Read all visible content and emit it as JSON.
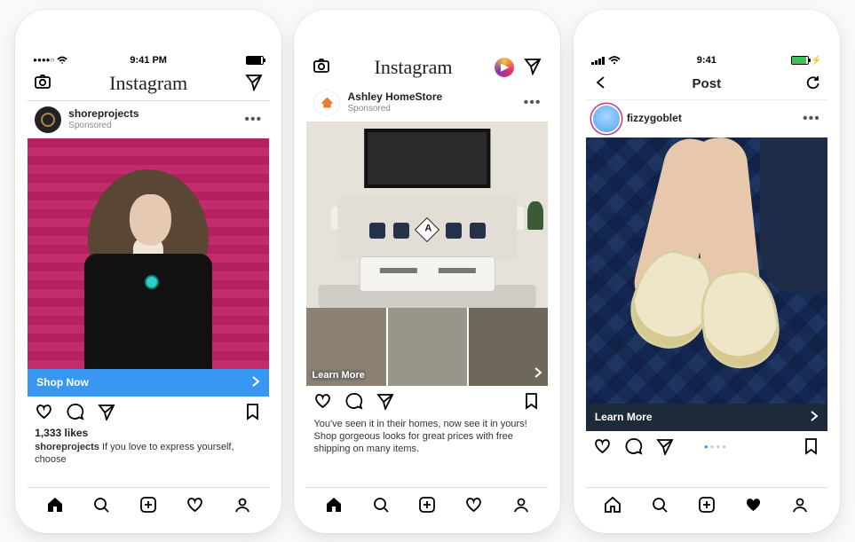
{
  "phone1": {
    "status": {
      "time": "9:41 PM"
    },
    "header": {
      "logo": "Instagram"
    },
    "profile": {
      "username": "shoreprojects",
      "sponsored": "Sponsored"
    },
    "cta": "Shop Now",
    "likes": "1,333 likes",
    "caption_user": "shoreprojects",
    "caption_text": "If you love to express yourself, choose"
  },
  "phone2": {
    "header": {
      "logo": "Instagram"
    },
    "profile": {
      "username": "Ashley HomeStore",
      "sponsored": "Sponsored"
    },
    "overlay_cta": "Learn More",
    "caption": "You've seen it in their homes, now see it in yours! Shop gorgeous looks for great prices with free shipping on many items."
  },
  "phone3": {
    "status": {
      "time": "9:41"
    },
    "header": {
      "title": "Post"
    },
    "profile": {
      "username": "fizzygoblet"
    },
    "cta": "Learn More"
  }
}
